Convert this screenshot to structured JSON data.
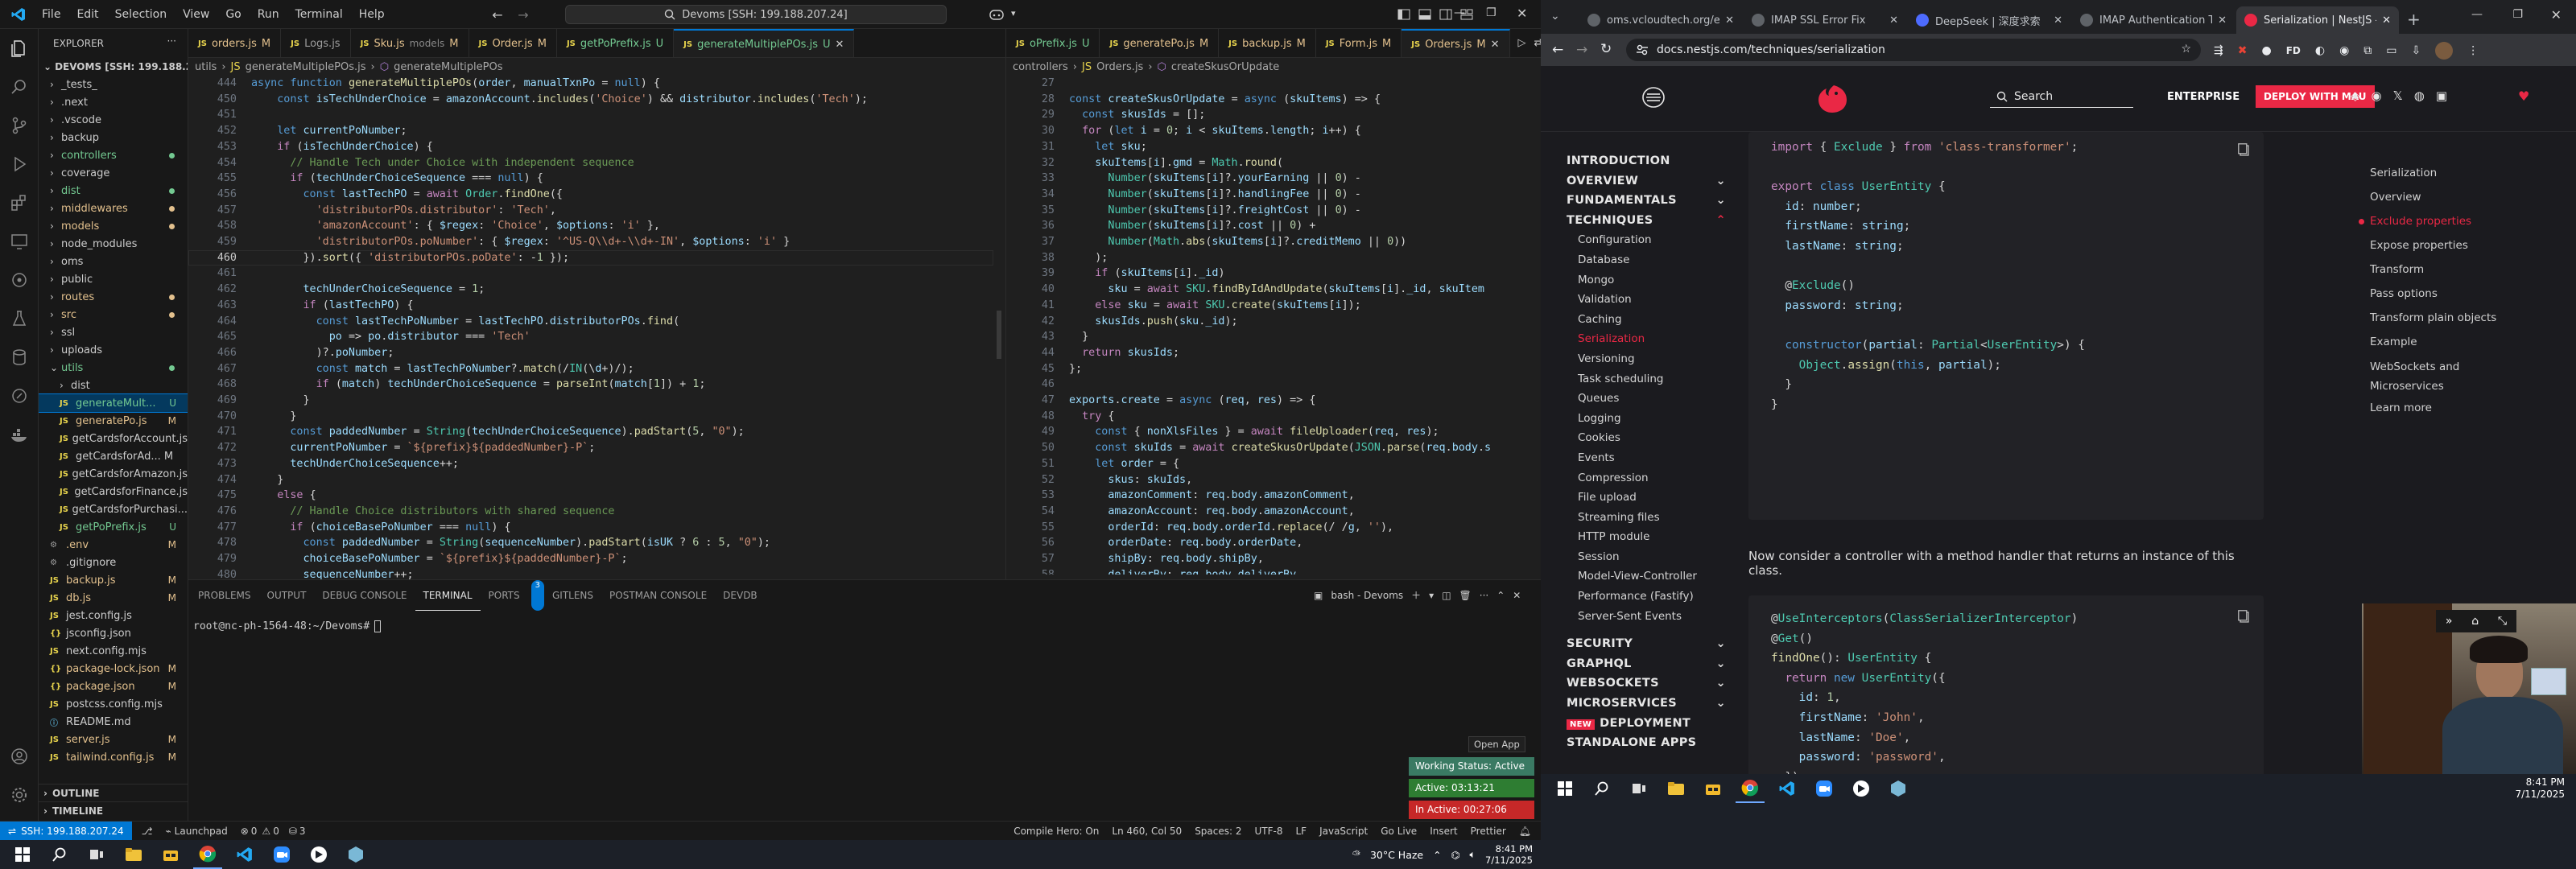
{
  "vscode": {
    "menu": [
      "File",
      "Edit",
      "Selection",
      "View",
      "Go",
      "Run",
      "Terminal",
      "Help"
    ],
    "search": "Devoms [SSH: 199.188.207.24]",
    "explorer": {
      "title": "EXPLORER",
      "root": "DEVOMS [SSH: 199.188.20...",
      "items": [
        {
          "label": "_tests_",
          "type": "folder",
          "mark": ""
        },
        {
          "label": ".next",
          "type": "folder",
          "mark": ""
        },
        {
          "label": ".vscode",
          "type": "folder",
          "mark": ""
        },
        {
          "label": "backup",
          "type": "folder",
          "mark": ""
        },
        {
          "label": "controllers",
          "type": "folder",
          "mark": "dot",
          "color": "#73c991"
        },
        {
          "label": "coverage",
          "type": "folder",
          "mark": ""
        },
        {
          "label": "dist",
          "type": "folder",
          "mark": "dot",
          "color": "#73c991"
        },
        {
          "label": "middlewares",
          "type": "folder",
          "mark": "dot",
          "color": "#e2c08d"
        },
        {
          "label": "models",
          "type": "folder",
          "mark": "dot",
          "color": "#e2c08d"
        },
        {
          "label": "node_modules",
          "type": "folder",
          "mark": ""
        },
        {
          "label": "oms",
          "type": "folder",
          "mark": ""
        },
        {
          "label": "public",
          "type": "folder",
          "mark": ""
        },
        {
          "label": "routes",
          "type": "folder",
          "mark": "dot",
          "color": "#e2c08d"
        },
        {
          "label": "src",
          "type": "folder",
          "mark": "dot",
          "color": "#e2c08d"
        },
        {
          "label": "ssl",
          "type": "folder",
          "mark": ""
        },
        {
          "label": "uploads",
          "type": "folder",
          "mark": ""
        },
        {
          "label": "utils",
          "type": "folder-open",
          "mark": "dot",
          "color": "#73c991"
        },
        {
          "label": "dist",
          "type": "folder-sub",
          "mark": ""
        },
        {
          "label": "generateMult...",
          "type": "js",
          "mark": "U",
          "color": "#73c991",
          "selected": true
        },
        {
          "label": "generatePo.js",
          "type": "js",
          "mark": "M",
          "color": "#e2c08d"
        },
        {
          "label": "getCardsforAccount.js",
          "type": "js",
          "mark": ""
        },
        {
          "label": "getCardsforAd... M",
          "type": "js",
          "mark": ""
        },
        {
          "label": "getCardsforAmazon.js",
          "type": "js",
          "mark": ""
        },
        {
          "label": "getCardsforFinance.js",
          "type": "js",
          "mark": ""
        },
        {
          "label": "getCardsforPurchasi...",
          "type": "js",
          "mark": ""
        },
        {
          "label": "getPoPrefix.js",
          "type": "js",
          "mark": "U",
          "color": "#73c991"
        },
        {
          "label": ".env",
          "type": "file",
          "mark": "M",
          "color": "#e2c08d"
        },
        {
          "label": ".gitignore",
          "type": "file",
          "mark": ""
        },
        {
          "label": "backup.js",
          "type": "js",
          "mark": "M",
          "color": "#e2c08d"
        },
        {
          "label": "db.js",
          "type": "js",
          "mark": "M",
          "color": "#e2c08d"
        },
        {
          "label": "jest.config.js",
          "type": "js",
          "mark": ""
        },
        {
          "label": "jsconfig.json",
          "type": "json",
          "mark": ""
        },
        {
          "label": "next.config.mjs",
          "type": "js",
          "mark": ""
        },
        {
          "label": "package-lock.json",
          "type": "json",
          "mark": "M",
          "color": "#e2c08d"
        },
        {
          "label": "package.json",
          "type": "json",
          "mark": "M",
          "color": "#e2c08d"
        },
        {
          "label": "postcss.config.mjs",
          "type": "js",
          "mark": ""
        },
        {
          "label": "README.md",
          "type": "md",
          "mark": ""
        },
        {
          "label": "server.js",
          "type": "js",
          "mark": "M",
          "color": "#e2c08d"
        },
        {
          "label": "tailwind.config.js",
          "type": "js",
          "mark": "M",
          "color": "#e2c08d"
        }
      ],
      "outline": "OUTLINE",
      "timeline": "TIMELINE"
    },
    "tabs1": [
      {
        "label": "orders.js",
        "mark": "M",
        "active": false
      },
      {
        "label": "Logs.js",
        "mark": "",
        "active": false
      },
      {
        "label": "Sku.js",
        "mark": "M",
        "extra": "models",
        "active": false
      },
      {
        "label": "Order.js",
        "mark": "M",
        "active": false
      },
      {
        "label": "getPoPrefix.js",
        "mark": "U",
        "active": false
      },
      {
        "label": "generateMultiplePOs.js",
        "mark": "U",
        "active": true
      }
    ],
    "tabs2": [
      {
        "label": "oPrefix.js",
        "mark": "U",
        "active": false
      },
      {
        "label": "generatePo.js",
        "mark": "M",
        "active": false
      },
      {
        "label": "backup.js",
        "mark": "M",
        "active": false
      },
      {
        "label": "Form.js",
        "mark": "M",
        "active": false
      },
      {
        "label": "Orders.js",
        "mark": "M",
        "active": true
      }
    ],
    "crumbs1": [
      "utils",
      "generateMultiplePOs.js",
      "generateMultiplePOs"
    ],
    "crumbs2": [
      "controllers",
      "Orders.js",
      "createSkusOrUpdate"
    ],
    "editor1_lines": [
      {
        "n": "444",
        "t": "async function generateMultiplePOs(order, manualTxnPo = null) {"
      },
      {
        "n": "450",
        "t": "    const isTechUnderChoice = amazonAccount.includes('Choice') && distributor.includes('Tech');"
      },
      {
        "n": "451",
        "t": ""
      },
      {
        "n": "452",
        "t": "    let currentPoNumber;"
      },
      {
        "n": "453",
        "t": "    if (isTechUnderChoice) {"
      },
      {
        "n": "454",
        "t": "      // Handle Tech under Choice with independent sequence"
      },
      {
        "n": "455",
        "t": "      if (techUnderChoiceSequence === null) {"
      },
      {
        "n": "456",
        "t": "        const lastTechPO = await Order.findOne({"
      },
      {
        "n": "457",
        "t": "          'distributorPOs.distributor': 'Tech',"
      },
      {
        "n": "458",
        "t": "          'amazonAccount': { $regex: 'Choice', $options: 'i' },"
      },
      {
        "n": "459",
        "t": "          'distributorPOs.poNumber': { $regex: '^US-Q\\\\d+-\\\\d+-IN', $options: 'i' }"
      },
      {
        "n": "460",
        "t": "        }).sort({ 'distributorPOs.poDate': -1 });"
      },
      {
        "n": "461",
        "t": ""
      },
      {
        "n": "462",
        "t": "        techUnderChoiceSequence = 1;"
      },
      {
        "n": "463",
        "t": "        if (lastTechPO) {"
      },
      {
        "n": "464",
        "t": "          const lastTechPoNumber = lastTechPO.distributorPOs.find("
      },
      {
        "n": "465",
        "t": "            po => po.distributor === 'Tech'"
      },
      {
        "n": "466",
        "t": "          )?.poNumber;"
      },
      {
        "n": "467",
        "t": "          const match = lastTechPoNumber?.match(/IN(\\d+)/);"
      },
      {
        "n": "468",
        "t": "          if (match) techUnderChoiceSequence = parseInt(match[1]) + 1;"
      },
      {
        "n": "469",
        "t": "        }"
      },
      {
        "n": "470",
        "t": "      }"
      },
      {
        "n": "471",
        "t": "      const paddedNumber = String(techUnderChoiceSequence).padStart(5, \"0\");"
      },
      {
        "n": "472",
        "t": "      currentPoNumber = `${prefix}${paddedNumber}-P`;"
      },
      {
        "n": "473",
        "t": "      techUnderChoiceSequence++;"
      },
      {
        "n": "474",
        "t": "    }"
      },
      {
        "n": "475",
        "t": "    else {"
      },
      {
        "n": "476",
        "t": "      // Handle Choice distributors with shared sequence"
      },
      {
        "n": "477",
        "t": "      if (choiceBasePoNumber === null) {"
      },
      {
        "n": "478",
        "t": "        const paddedNumber = String(sequenceNumber).padStart(isUK ? 6 : 5, \"0\");"
      },
      {
        "n": "479",
        "t": "        choiceBasePoNumber = `${prefix}${paddedNumber}-P`;"
      },
      {
        "n": "480",
        "t": "        sequenceNumber++;"
      },
      {
        "n": "481",
        "t": "      }"
      }
    ],
    "editor2_lines": [
      {
        "n": "27",
        "t": ""
      },
      {
        "n": "28",
        "t": "const createSkusOrUpdate = async (skuItems) => {"
      },
      {
        "n": "29",
        "t": "  const skusIds = [];"
      },
      {
        "n": "30",
        "t": "  for (let i = 0; i < skuItems.length; i++) {"
      },
      {
        "n": "31",
        "t": "    let sku;"
      },
      {
        "n": "32",
        "t": "    skuItems[i].gmd = Math.round("
      },
      {
        "n": "33",
        "t": "      Number(skuItems[i]?.yourEarning || 0) -"
      },
      {
        "n": "34",
        "t": "      Number(skuItems[i]?.handlingFee || 0) -"
      },
      {
        "n": "35",
        "t": "      Number(skuItems[i]?.freightCost || 0) -"
      },
      {
        "n": "36",
        "t": "      Number(skuItems[i]?.cost || 0) +"
      },
      {
        "n": "37",
        "t": "      Number(Math.abs(skuItems[i]?.creditMemo || 0))"
      },
      {
        "n": "38",
        "t": "    );"
      },
      {
        "n": "39",
        "t": "    if (skuItems[i]._id)"
      },
      {
        "n": "40",
        "t": "      sku = await SKU.findByIdAndUpdate(skuItems[i]._id, skuItem"
      },
      {
        "n": "41",
        "t": "    else sku = await SKU.create(skuItems[i]);"
      },
      {
        "n": "42",
        "t": "    skusIds.push(sku._id);"
      },
      {
        "n": "43",
        "t": "  }"
      },
      {
        "n": "44",
        "t": "  return skusIds;"
      },
      {
        "n": "45",
        "t": "};"
      },
      {
        "n": "46",
        "t": ""
      },
      {
        "n": "47",
        "t": "exports.create = async (req, res) => {"
      },
      {
        "n": "48",
        "t": "  try {"
      },
      {
        "n": "49",
        "t": "    const { nonXlsFiles } = await fileUploader(req, res);"
      },
      {
        "n": "50",
        "t": "    const skuIds = await createSkusOrUpdate(JSON.parse(req.body.s"
      },
      {
        "n": "51",
        "t": "    let order = {"
      },
      {
        "n": "52",
        "t": "      skus: skuIds,"
      },
      {
        "n": "53",
        "t": "      amazonComment: req.body.amazonComment,"
      },
      {
        "n": "54",
        "t": "      amazonAccount: req.body.amazonAccount,"
      },
      {
        "n": "55",
        "t": "      orderId: req.body.orderId.replace(/ /g, ''),"
      },
      {
        "n": "56",
        "t": "      orderDate: req.body.orderDate,"
      },
      {
        "n": "57",
        "t": "      shipBy: req.body.shipBy,"
      },
      {
        "n": "58",
        "t": "      deliverBy: req.body.deliverBy,"
      },
      {
        "n": "59",
        "t": ""
      }
    ],
    "panel_tabs": [
      "PROBLEMS",
      "OUTPUT",
      "DEBUG CONSOLE",
      "TERMINAL",
      "PORTS",
      "GITLENS",
      "POSTMAN CONSOLE",
      "DEVDB"
    ],
    "ports_badge": "3",
    "terminal_name": "bash - Devoms",
    "terminal_prompt": "root@nc-ph-1564-48:~/Devoms#",
    "open_app": "Open App",
    "working_status": [
      "Working Status: Active",
      "Active: 03:13:21",
      "In Active: 00:27:06"
    ],
    "status": {
      "remote": "SSH: 199.188.207.24",
      "launchpad": "Launchpad",
      "errors": "0",
      "warnings": "0",
      "ports": "3",
      "compile": "Compile Hero: On",
      "position": "Ln 460, Col 50",
      "spaces": "Spaces: 2",
      "encoding": "UTF-8",
      "eol": "LF",
      "language": "JavaScript",
      "golive": "Go Live",
      "insert": "Insert",
      "prettier": "Prettier"
    },
    "taskbar": {
      "weather": "30°C Haze",
      "time": "8:41 PM",
      "date": "7/11/2025"
    }
  },
  "chrome": {
    "tabs": [
      {
        "label": "oms.vcloudtech.org/errors",
        "active": false
      },
      {
        "label": "IMAP SSL Error Fix",
        "active": false
      },
      {
        "label": "DeepSeek | 深度求索",
        "active": false
      },
      {
        "label": "IMAP Authentication Te",
        "active": false
      },
      {
        "label": "Serialization | NestJS - A",
        "active": true
      }
    ],
    "url": "docs.nestjs.com/techniques/serialization",
    "header": {
      "search": "Search",
      "enterprise": "ENTERPRISE",
      "cta": "DEPLOY WITH MAU"
    },
    "nav": [
      {
        "label": "INTRODUCTION",
        "kind": "head"
      },
      {
        "label": "OVERVIEW",
        "kind": "head",
        "chev": "down"
      },
      {
        "label": "FUNDAMENTALS",
        "kind": "head",
        "chev": "down"
      },
      {
        "label": "TECHNIQUES",
        "kind": "head",
        "chev": "up"
      },
      {
        "label": "Configuration",
        "kind": "sub"
      },
      {
        "label": "Database",
        "kind": "sub"
      },
      {
        "label": "Mongo",
        "kind": "sub"
      },
      {
        "label": "Validation",
        "kind": "sub"
      },
      {
        "label": "Caching",
        "kind": "sub"
      },
      {
        "label": "Serialization",
        "kind": "sub",
        "active": true
      },
      {
        "label": "Versioning",
        "kind": "sub"
      },
      {
        "label": "Task scheduling",
        "kind": "sub"
      },
      {
        "label": "Queues",
        "kind": "sub"
      },
      {
        "label": "Logging",
        "kind": "sub"
      },
      {
        "label": "Cookies",
        "kind": "sub"
      },
      {
        "label": "Events",
        "kind": "sub"
      },
      {
        "label": "Compression",
        "kind": "sub"
      },
      {
        "label": "File upload",
        "kind": "sub"
      },
      {
        "label": "Streaming files",
        "kind": "sub"
      },
      {
        "label": "HTTP module",
        "kind": "sub"
      },
      {
        "label": "Session",
        "kind": "sub"
      },
      {
        "label": "Model-View-Controller",
        "kind": "sub"
      },
      {
        "label": "Performance (Fastify)",
        "kind": "sub"
      },
      {
        "label": "Server-Sent Events",
        "kind": "sub"
      },
      {
        "label": "",
        "kind": "gap"
      },
      {
        "label": "SECURITY",
        "kind": "head",
        "chev": "down"
      },
      {
        "label": "GRAPHQL",
        "kind": "head",
        "chev": "down"
      },
      {
        "label": "WEBSOCKETS",
        "kind": "head",
        "chev": "down"
      },
      {
        "label": "MICROSERVICES",
        "kind": "head",
        "chev": "down"
      },
      {
        "label": "DEPLOYMENT",
        "kind": "head",
        "badge": "NEW"
      },
      {
        "label": "STANDALONE APPS",
        "kind": "head"
      }
    ],
    "code1": [
      "import { Exclude } from 'class-transformer';",
      "",
      "export class UserEntity {",
      "  id: number;",
      "  firstName: string;",
      "  lastName: string;",
      "",
      "  @Exclude()",
      "  password: string;",
      "",
      "  constructor(partial: Partial<UserEntity>) {",
      "    Object.assign(this, partial);",
      "  }",
      "}"
    ],
    "paragraph": "Now consider a controller with a method handler that returns an instance of this class.",
    "code2": [
      "@UseInterceptors(ClassSerializerInterceptor)",
      "@Get()",
      "findOne(): UserEntity {",
      "  return new UserEntity({",
      "    id: 1,",
      "    firstName: 'John',",
      "    lastName: 'Doe',",
      "    password: 'password',",
      "  });",
      "}"
    ],
    "toc": [
      {
        "label": "Serialization"
      },
      {
        "label": "Overview"
      },
      {
        "label": "Exclude properties",
        "active": true
      },
      {
        "label": "Expose properties"
      },
      {
        "label": "Transform"
      },
      {
        "label": "Pass options"
      },
      {
        "label": "Transform plain objects"
      },
      {
        "label": "Example"
      },
      {
        "label": "WebSockets and"
      },
      {
        "label": "Microservices"
      },
      {
        "label": "Learn more"
      }
    ],
    "taskbar": {
      "time": "8:41 PM",
      "date": "7/11/2025"
    }
  },
  "colors": {
    "accent": "#0078d4",
    "nest_red": "#ea2845",
    "status_green": "#2e7d32",
    "status_red": "#c62828"
  }
}
